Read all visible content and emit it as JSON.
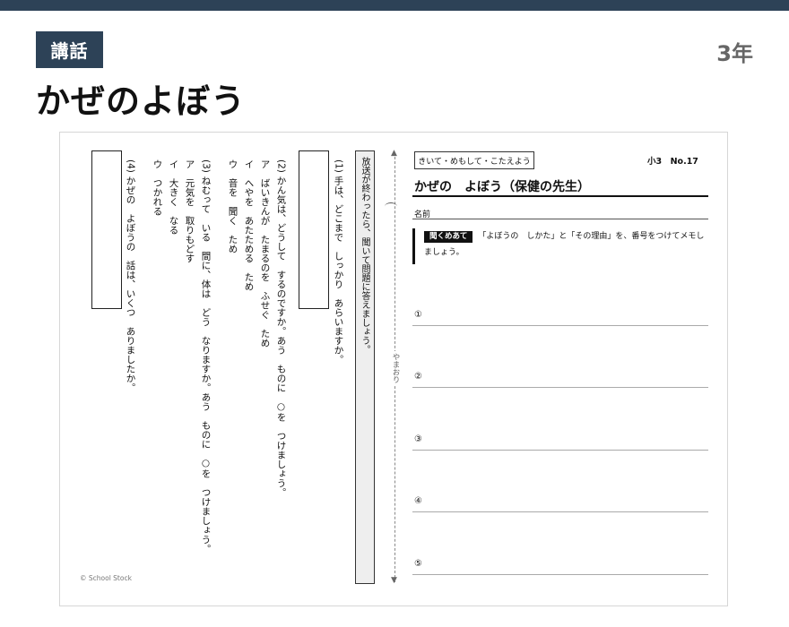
{
  "header": {
    "badge": "講話",
    "grade": "3年",
    "title": "かぜのよぼう"
  },
  "worksheet": {
    "instructions_vertical": "放送が終わったら、聞いて問題に答えましょう。",
    "fold_label": "やまおり",
    "questions": [
      {
        "lines": [
          "(1) 手は、どこまで　しっかり　あらいますか。"
        ]
      },
      {
        "lines": [
          "(2) かん気は、どうして　するのですか。あう　ものに　○を　つけましょう。",
          "ア　ばいきんが　たまるのを　ふせぐ　ため",
          "イ　へやを　あたためる　ため",
          "ウ　音を　聞く　ため"
        ]
      },
      {
        "lines": [
          "(3) ねむって　いる　間に、体は　どう　なりますか。あう　ものに　○を　つけましょう。",
          "ア　元気を　取りもどす",
          "イ　大きく　なる",
          "ウ　つかれる"
        ]
      },
      {
        "lines": [
          "(4) かぜの　よぼうの　話は、いくつ　ありましたか。"
        ]
      }
    ],
    "copyright": "© School Stock",
    "right": {
      "tag": "きいて・めもして・こたえよう",
      "number": "小3　No.17",
      "title": "かぜの　よぼう（保健の先生）",
      "name_label": "名前",
      "listen_label": "聞くめあて",
      "instruction": "「よぼうの　しかた」と「その理由」を、番号をつけてメモしましょう。",
      "lines": [
        "①",
        "②",
        "③",
        "④",
        "⑤"
      ]
    }
  }
}
